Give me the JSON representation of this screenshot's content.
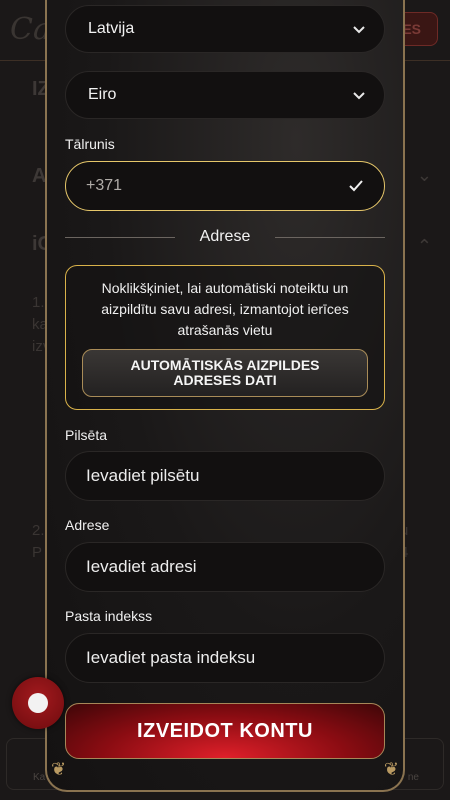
{
  "background": {
    "logo_text": "Cas",
    "header_button_label": "ES",
    "rows": [
      "IZ",
      "A",
      "iC"
    ],
    "text_1": [
      "1.",
      "ka",
      "izv"
    ],
    "text_2": [
      "2.",
      "P"
    ],
    "right_fragments": [
      "u",
      "4"
    ],
    "bottom_labels": [
      "Ka",
      "ne"
    ]
  },
  "form": {
    "country_select": {
      "value": "Latvija"
    },
    "currency_select": {
      "value": "Eiro"
    },
    "phone": {
      "label": "Tālrunis",
      "value": "+371"
    },
    "address_section_title": "Adrese",
    "autofill": {
      "description": "Noklikšķiniet, lai automātiski noteiktu un aizpildītu savu adresi, izmantojot ierīces atrašanās vietu",
      "button_label": "AUTOMĀTISKĀS AIZPILDES ADRESES DATI"
    },
    "city": {
      "label": "Pilsēta",
      "placeholder": "Ievadiet pilsētu"
    },
    "address": {
      "label": "Adrese",
      "placeholder": "Ievadiet adresi"
    },
    "postal": {
      "label": "Pasta indekss",
      "placeholder": "Ievadiet pasta indeksu"
    },
    "submit_label": "IZVEIDOT KONTU"
  },
  "colors": {
    "accent_gold": "#d9b24a",
    "submit_red": "#c4141c"
  }
}
